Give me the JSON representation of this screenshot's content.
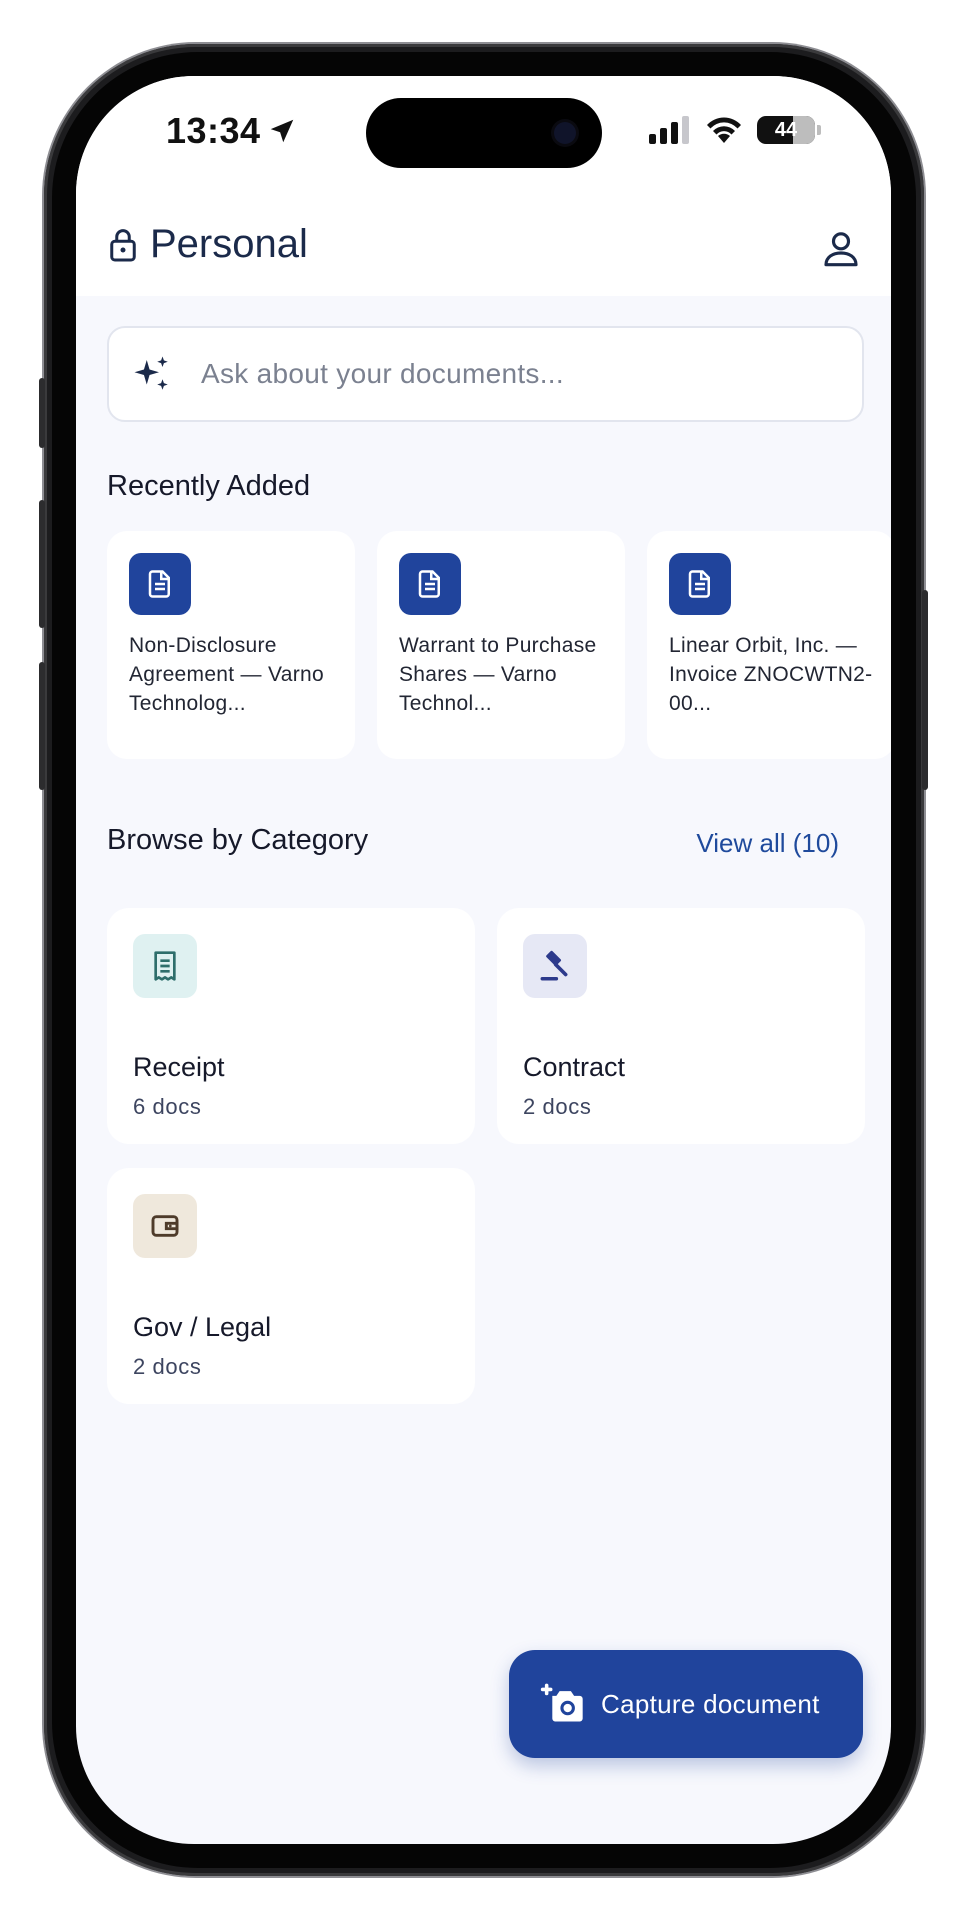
{
  "status_bar": {
    "time": "13:34",
    "battery": "44"
  },
  "header": {
    "title": "Personal"
  },
  "search": {
    "placeholder": "Ask about your documents..."
  },
  "recent": {
    "title": "Recently Added",
    "items": [
      {
        "title": "Non-Disclosure Agreement — Varno Technolog..."
      },
      {
        "title": "Warrant to Purchase Shares — Varno Technol..."
      },
      {
        "title": "Linear Orbit, Inc. — Invoice ZNOCWTN2-00..."
      }
    ]
  },
  "categories": {
    "title": "Browse by Category",
    "view_all": "View all (10)",
    "items": [
      {
        "name": "Receipt",
        "count": "6 docs",
        "icon": "receipt-icon",
        "icon_bg": "#dff1f1",
        "icon_color": "#2e6e6b"
      },
      {
        "name": "Contract",
        "count": "2 docs",
        "icon": "gavel-icon",
        "icon_bg": "#e6e8f5",
        "icon_color": "#2d3a8c"
      },
      {
        "name": "Gov / Legal",
        "count": "2 docs",
        "icon": "wallet-icon",
        "icon_bg": "#efe8dc",
        "icon_color": "#4e3b2a"
      }
    ]
  },
  "fab": {
    "label": "Capture document"
  },
  "colors": {
    "accent": "#20449c",
    "background": "#f7f8fd"
  }
}
